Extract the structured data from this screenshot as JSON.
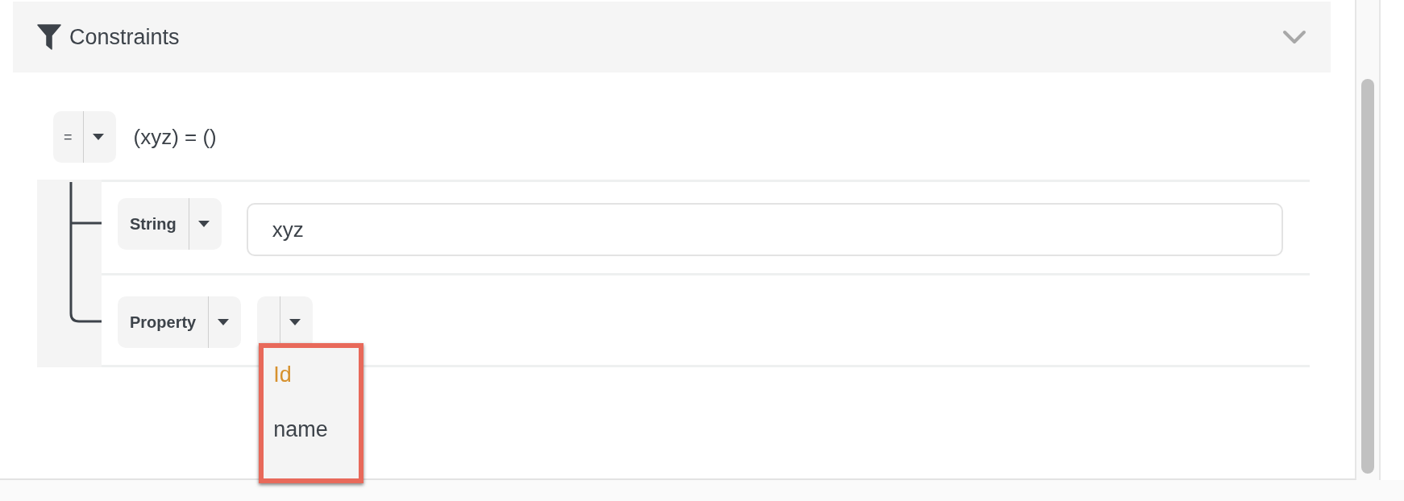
{
  "panel": {
    "title": "Constraints",
    "expanded": true
  },
  "expression": {
    "operator": "=",
    "summary": "(xyz) = ()"
  },
  "operands": [
    {
      "kind": "string",
      "type": "String",
      "value": "xyz"
    },
    {
      "kind": "property",
      "type": "Property",
      "menu": {
        "open": true,
        "options": [
          {
            "label": "Id",
            "selected": true
          },
          {
            "label": "name",
            "selected": false
          }
        ]
      }
    }
  ]
}
